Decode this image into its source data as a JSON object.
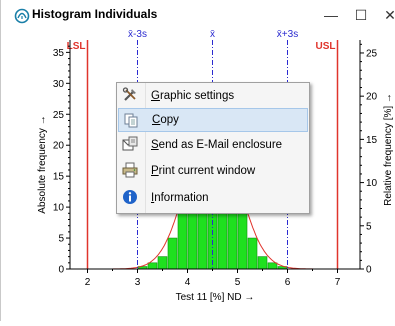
{
  "window": {
    "title": "Histogram Individuals",
    "minimize_glyph": "—",
    "maximize_glyph": "☐",
    "close_glyph": "✕"
  },
  "chart_data": {
    "type": "bar",
    "xlabel": "Test 11 [%]  ND →",
    "ylabel_left": "Absolute frequency →",
    "ylabel_right": "Relative frequency  [%] →",
    "xlim": [
      1.65,
      7.45
    ],
    "ylim_left": [
      0,
      37
    ],
    "ylim_right": [
      0,
      26.5
    ],
    "x_ticks": [
      2,
      3,
      4,
      5,
      6,
      7
    ],
    "y_ticks_left": [
      0,
      5,
      10,
      15,
      20,
      25,
      30,
      35
    ],
    "y_ticks_right": [
      0,
      5,
      10,
      15,
      20,
      25
    ],
    "bin_width": 0.2,
    "bins": [
      {
        "x": 3.1,
        "value": 0.4
      },
      {
        "x": 3.3,
        "value": 1
      },
      {
        "x": 3.5,
        "value": 2
      },
      {
        "x": 3.7,
        "value": 5
      },
      {
        "x": 3.9,
        "value": 10
      },
      {
        "x": 4.1,
        "value": 16
      },
      {
        "x": 4.3,
        "value": 22
      },
      {
        "x": 4.5,
        "value": 24
      },
      {
        "x": 4.7,
        "value": 20
      },
      {
        "x": 4.9,
        "value": 14
      },
      {
        "x": 5.1,
        "value": 10
      },
      {
        "x": 5.3,
        "value": 5
      },
      {
        "x": 5.5,
        "value": 2
      },
      {
        "x": 5.7,
        "value": 1
      },
      {
        "x": 5.9,
        "value": 0.4
      }
    ],
    "normal_curve": {
      "mean": 4.5,
      "sd": 0.5
    },
    "limits": [
      {
        "label": "LSL",
        "x": 2.0,
        "color": "#e0342c"
      },
      {
        "label": "USL",
        "x": 7.0,
        "color": "#e0342c"
      }
    ],
    "sigma_lines": [
      {
        "label": "x̄-3s",
        "x": 3.0,
        "color": "#2a2ad0"
      },
      {
        "label": "x̄",
        "x": 4.5,
        "color": "#2a2ad0"
      },
      {
        "label": "x̄+3s",
        "x": 6.0,
        "color": "#2a2ad0"
      }
    ],
    "colors": {
      "bar": "#1fe01f",
      "bar_edge": "#0a8f0a",
      "curve": "#e0342c",
      "axis": "#000000"
    }
  },
  "context_menu": {
    "items": [
      {
        "label": "Graphic settings",
        "icon": "tools-icon",
        "selected": false
      },
      {
        "label": "Copy",
        "icon": "copy-icon",
        "selected": true
      },
      {
        "label": "Send as E-Mail enclosure",
        "icon": "email-icon",
        "selected": false
      },
      {
        "label": "Print current window",
        "icon": "print-icon",
        "selected": false
      },
      {
        "label": "Information",
        "icon": "info-icon",
        "selected": false
      }
    ]
  }
}
